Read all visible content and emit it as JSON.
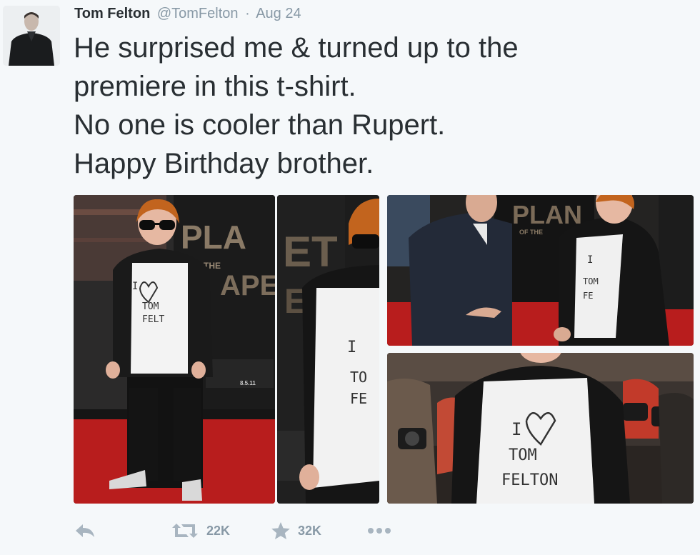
{
  "tweet": {
    "author_name": "Tom Felton",
    "author_handle": "@TomFelton",
    "separator": "·",
    "date": "Aug 24",
    "text_lines": [
      "He surprised me & turned up to the",
      "premiere in this t-shirt.",
      "No one is cooler than Rupert.",
      "Happy Birthday brother."
    ],
    "photos": {
      "photo_1": {
        "shirt_text": [
          "I",
          "TOM",
          "FELT"
        ],
        "poster_text": [
          "PLA",
          "THE",
          "APE",
          "8.5.11"
        ]
      },
      "photo_2": {
        "shirt_text": [
          "I",
          "TO",
          "FE"
        ],
        "poster_text": [
          "ET",
          "ES"
        ]
      },
      "photo_3": {
        "shirt_text": [
          "I",
          "TOM",
          "FE"
        ],
        "poster_text": [
          "PLAN",
          "OF THE"
        ]
      },
      "photo_4": {
        "shirt_text": [
          "I",
          "TOM",
          "FELTON"
        ]
      }
    },
    "actions": {
      "reply_icon": "reply-icon",
      "retweet_count": "22K",
      "favorite_count": "32K",
      "more_icon": "more-icon"
    }
  },
  "colors": {
    "text": "#292f33",
    "meta": "#8899a6",
    "action_icon": "#a8b5c0",
    "background": "#f5f8fa",
    "red_carpet": "#b81d1d"
  }
}
